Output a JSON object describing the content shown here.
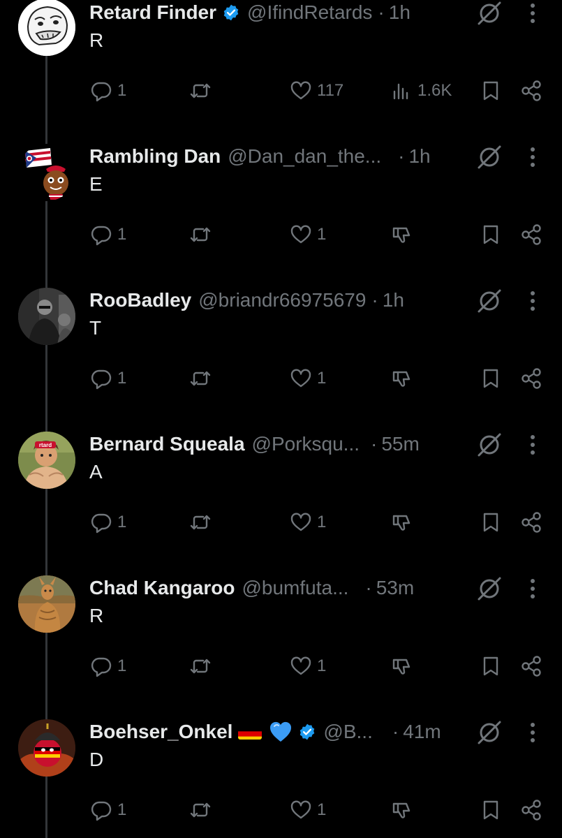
{
  "colors": {
    "background": "#000000",
    "text_primary": "#e7e9ea",
    "text_secondary": "#71767b",
    "verified": "#1d9bf0",
    "thread_line": "#333639"
  },
  "icons": {
    "verified": "verified-badge-icon",
    "grok": "grok-icon",
    "more": "more-dots-icon",
    "reply": "reply-bubble-icon",
    "retweet": "retweet-arrows-icon",
    "like": "heart-outline-icon",
    "views": "bar-chart-icon",
    "downvote": "downvote-icon",
    "bookmark": "bookmark-icon",
    "share": "share-icon"
  },
  "tweets": [
    {
      "name": "Retard Finder",
      "handle": "@IfindRetards",
      "separator": "·",
      "time": "1h",
      "text": "R",
      "reply_count": "1",
      "like_count": "117",
      "views_count": "1.6K"
    },
    {
      "name": "Rambling Dan",
      "handle": "@Dan_dan_the...",
      "separator": "·",
      "time": "1h",
      "text": "E",
      "reply_count": "1",
      "like_count": "1"
    },
    {
      "name": "RooBadley",
      "handle": "@briandr66975679",
      "separator": "·",
      "time": "1h",
      "text": "T",
      "reply_count": "1",
      "like_count": "1"
    },
    {
      "name": "Bernard Squeala",
      "handle": "@Porksqu...",
      "separator": "·",
      "time": "55m",
      "text": "A",
      "reply_count": "1",
      "like_count": "1",
      "avatar_text": "rtard"
    },
    {
      "name": "Chad Kangaroo",
      "handle": "@bumfuta...",
      "separator": "·",
      "time": "53m",
      "text": "R",
      "reply_count": "1",
      "like_count": "1"
    },
    {
      "name": "Boehser_Onkel",
      "handle": "@B...",
      "separator": "·",
      "time": "41m",
      "text": "D",
      "reply_count": "1",
      "like_count": "1"
    }
  ]
}
